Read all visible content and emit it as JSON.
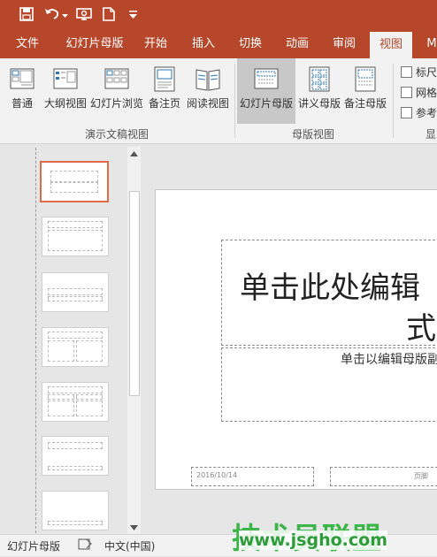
{
  "quick_access": {
    "save_icon": "save-icon",
    "undo_icon": "undo-icon",
    "redo_icon": "redo-icon",
    "start_slideshow_icon": "slideshow-icon",
    "new_icon": "new-document-icon",
    "customize_icon": "customize-icon"
  },
  "tabs": [
    {
      "label": "文件"
    },
    {
      "label": "幻灯片母版"
    },
    {
      "label": "开始"
    },
    {
      "label": "插入"
    },
    {
      "label": "切换"
    },
    {
      "label": "动画"
    },
    {
      "label": "审阅"
    },
    {
      "label": "视图"
    },
    {
      "label": "M"
    }
  ],
  "active_tab": "视图",
  "ribbon": {
    "presentation_views": {
      "group_label": "演示文稿视图",
      "buttons": [
        {
          "label": "普通"
        },
        {
          "label": "大纲视图"
        },
        {
          "label": "幻灯片浏览"
        },
        {
          "label": "备注页"
        },
        {
          "label": "阅读视图"
        }
      ]
    },
    "master_views": {
      "group_label": "母版视图",
      "buttons": [
        {
          "label": "幻灯片母版"
        },
        {
          "label": "讲义母版"
        },
        {
          "label": "备注母版"
        }
      ]
    },
    "show": {
      "group_label": "显",
      "options": [
        {
          "label": "标尺",
          "checked": false
        },
        {
          "label": "网格",
          "checked": false
        },
        {
          "label": "参考",
          "checked": false
        }
      ]
    }
  },
  "slide": {
    "title_text": "单击此处编辑",
    "title_text_line2": "式",
    "subtitle_text": "单击以编辑母版副",
    "date_text": "2016/10/14",
    "footer_text": "页脚"
  },
  "status_bar": {
    "view_label": "幻灯片母版",
    "language": "中文(中国)"
  },
  "watermark": {
    "line1": "技术员联盟",
    "line2": "www.jsgho.com"
  },
  "colors": {
    "accent": "#b7472a",
    "selected_thumb_border": "#e06a48",
    "watermark": "#3cb54a"
  }
}
